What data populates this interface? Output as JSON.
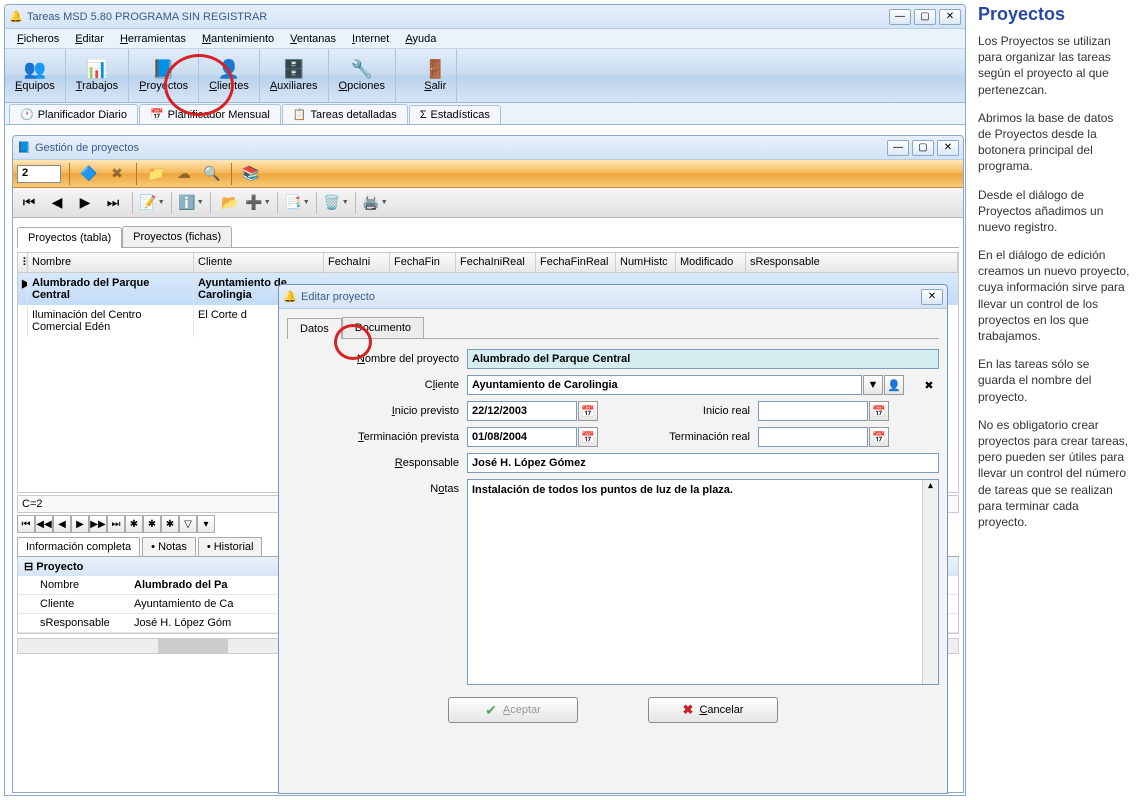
{
  "main_window": {
    "title": "Tareas MSD 5.80 PROGRAMA SIN REGISTRAR",
    "menu": [
      "Ficheros",
      "Editar",
      "Herramientas",
      "Mantenimiento",
      "Ventanas",
      "Internet",
      "Ayuda"
    ],
    "toolbar": [
      {
        "label": "Equipos",
        "u": "E",
        "icon": "👥"
      },
      {
        "label": "Trabajos",
        "u": "T",
        "icon": "📊"
      },
      {
        "label": "Proyectos",
        "u": "P",
        "icon": "📘",
        "highlighted": true
      },
      {
        "label": "Clientes",
        "u": "C",
        "icon": "👤"
      },
      {
        "label": "Auxiliares",
        "u": "A",
        "icon": "🗄️"
      },
      {
        "label": "Opciones",
        "u": "O",
        "icon": "🔧"
      },
      {
        "label": "Salir",
        "u": "S",
        "icon": "🚪"
      }
    ],
    "tabs": [
      {
        "label": "Planificador Diario",
        "icon": "🕐"
      },
      {
        "label": "Planificador Mensual",
        "icon": "📅"
      },
      {
        "label": "Tareas detalladas",
        "icon": "📋"
      },
      {
        "label": "Estadísticas",
        "icon": "Σ"
      }
    ]
  },
  "gestion_window": {
    "title": "Gestión de proyectos",
    "count": "2",
    "tabs": [
      "Proyectos (tabla)",
      "Proyectos (fichas)"
    ],
    "columns": [
      "Nombre",
      "Cliente",
      "FechaIni",
      "FechaFin",
      "FechaIniReal",
      "FechaFinReal",
      "NumHistc",
      "Modificado",
      "sResponsable"
    ],
    "rows": [
      {
        "nombre": "Alumbrado del Parque Central",
        "cliente": "Ayuntamiento de Carolingia",
        "selected": true
      },
      {
        "nombre": "Iluminación del Centro Comercial Edén",
        "cliente": "El Corte d",
        "selected": false
      }
    ],
    "status": "C=2",
    "info_tabs": [
      "Información completa",
      "• Notas",
      "• Historial"
    ],
    "info_header": "Proyecto",
    "info": [
      {
        "k": "Nombre",
        "v": "Alumbrado del Pa"
      },
      {
        "k": "Cliente",
        "v": "Ayuntamiento de Ca"
      },
      {
        "k": "sResponsable",
        "v": "José H. López Góm"
      }
    ]
  },
  "edit_dialog": {
    "title": "Editar proyecto",
    "tabs": [
      "Datos",
      "Documento"
    ],
    "labels": {
      "nombre": "Nombre del proyecto",
      "cliente": "Cliente",
      "inicio_previsto": "Inicio previsto",
      "terminacion_prevista": "Terminación prevista",
      "inicio_real": "Inicio real",
      "terminacion_real": "Terminación real",
      "responsable": "Responsable",
      "notas": "Notas"
    },
    "values": {
      "nombre": "Alumbrado del Parque Central",
      "cliente": "Ayuntamiento de Carolingia",
      "inicio_previsto": "22/12/2003",
      "terminacion_prevista": "01/08/2004",
      "inicio_real": "",
      "terminacion_real": "",
      "responsable": "José H. López Gómez",
      "notas": "Instalación de todos los puntos de luz de la plaza."
    },
    "buttons": {
      "aceptar": "Aceptar",
      "cancelar": "Cancelar"
    }
  },
  "help": {
    "title": "Proyectos",
    "paragraphs": [
      "Los Proyectos se utilizan para organizar las tareas según el proyecto al que pertenezcan.",
      "Abrimos la base de datos de Proyectos desde la botonera principal del programa.",
      "Desde el diálogo de Proyectos añadimos un nuevo registro.",
      "En el diálogo de edición creamos un nuevo proyecto, cuya información sirve para llevar un control de los proyectos en los que trabajamos.",
      "En las tareas sólo se guarda el nombre del proyecto.",
      "No es obligatorio crear proyectos para crear tareas, pero pueden ser útiles para llevar un control del número de tareas que se realizan para terminar cada proyecto."
    ]
  }
}
